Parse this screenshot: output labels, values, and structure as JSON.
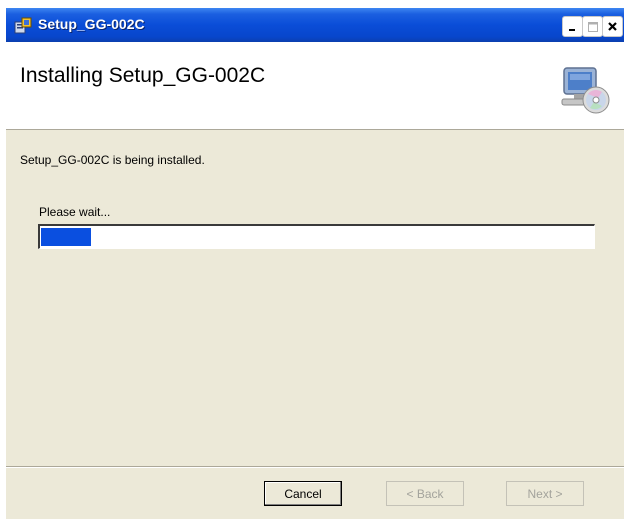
{
  "window": {
    "title": "Setup_GG-002C",
    "icon": "installer-icon",
    "controls": {
      "minimize": "_",
      "maximize": "□",
      "close": "×"
    }
  },
  "banner": {
    "heading": "Installing Setup_GG-002C",
    "icon": "computer-cd-icon"
  },
  "main": {
    "status_text": "Setup_GG-002C is being installed.",
    "progress_label": "Please wait...",
    "progress_fraction": 0.09
  },
  "buttons": {
    "cancel": "Cancel",
    "back": "< Back",
    "next": "Next >"
  },
  "colors": {
    "titlebar": "#0a4dd8",
    "progress_fill": "#0a4fe0",
    "dialog_bg": "#ece9d8"
  }
}
